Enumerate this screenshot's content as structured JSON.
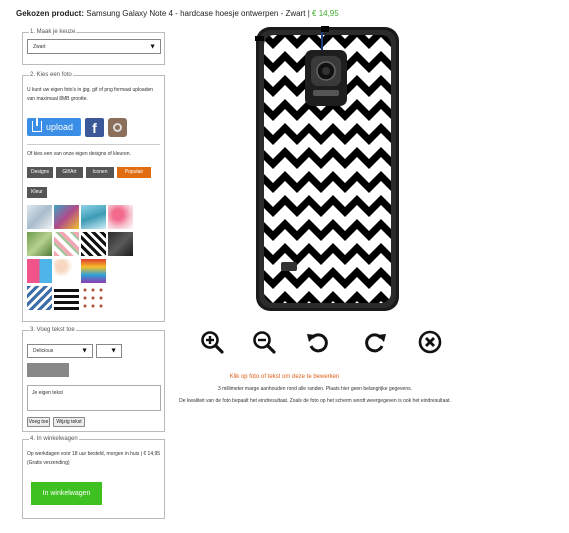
{
  "header": {
    "label": "Gekozen product:",
    "product": "Samsung Galaxy Note 4 - hardcase hoesje ontwerpen - Zwart",
    "sep": "|",
    "price": "€ 14,95"
  },
  "section1": {
    "legend": "1. Maak je keuze",
    "select_value": "Zwart"
  },
  "section2": {
    "legend": "2. Kies een foto",
    "intro": "U kunt uw eigen foto's in jpg, gif of png formaat uploaden van maximaal 8MB grootte.",
    "upload_label": "upload",
    "facebook_glyph": "f",
    "designs_intro": "Of kies een van onze eigen designs of kleuren.",
    "tags": [
      "Designs",
      "Gif/Art",
      "Iconen",
      "Populair",
      "Kleur"
    ],
    "active_tag": "Populair"
  },
  "section3": {
    "legend": "3. Voeg tekst toe",
    "font_value": "Delicious",
    "textarea_placeholder": "Je eigen tekst",
    "add_button": "Voeg toe",
    "clear_button": "Wijzig tekst",
    "text_color": "#888888"
  },
  "section4": {
    "legend": "4. In winkelwagen",
    "delivery": "Op werkdagen voor 18 uur besteld, morgen in huis | € 14,95 (Gratis verzending)",
    "cart_button": "In winkelwagen"
  },
  "editor": {
    "hint": "Klik op foto of tekst om deze te bewerken",
    "note1": "3 millimeter marge aanhouden rond alle randen. Plaats hier geen belangrijke gegevens.",
    "note2": "De kwaliteit van de foto bepaalt het eindresultaat. Zoals de foto op het scherm wordt weergegeven is ook het eindresultaat.",
    "controls": [
      "zoom-in-icon",
      "zoom-out-icon",
      "rotate-left-icon",
      "rotate-right-icon",
      "delete-icon"
    ]
  },
  "colors": {
    "accent_orange": "#e26c10",
    "upload_blue": "#3a8ee6",
    "cart_green": "#3ec221",
    "price_green": "#3cae2a"
  }
}
